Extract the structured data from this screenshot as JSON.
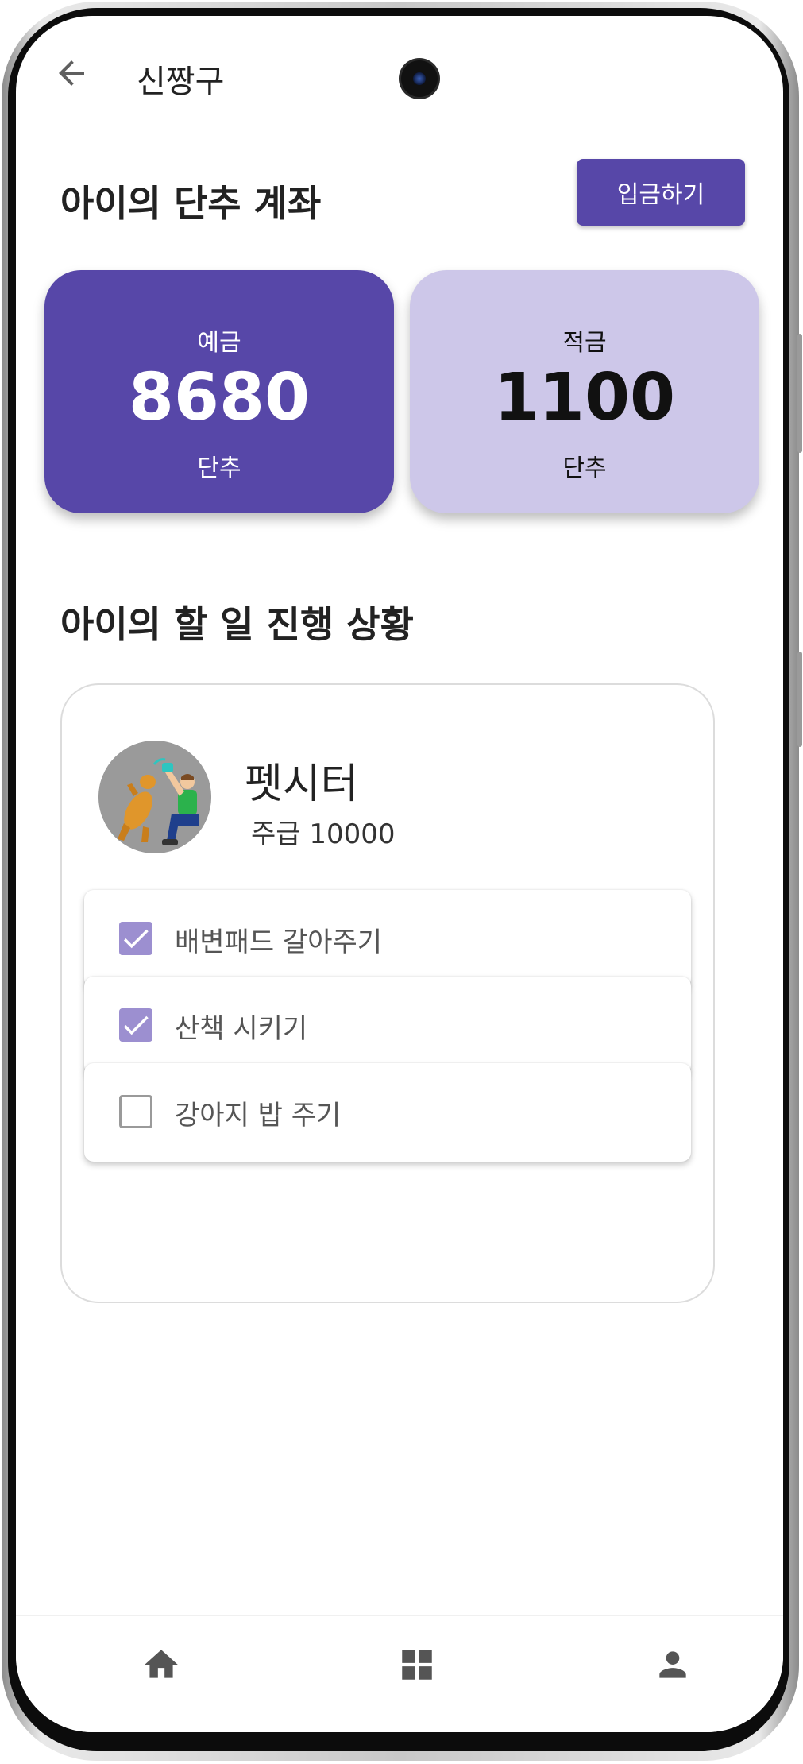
{
  "app_bar": {
    "title": "신짱구",
    "back_icon": "arrow-back-icon"
  },
  "account_section": {
    "title": "아이의 단추 계좌",
    "deposit_button": "입금하기",
    "accounts": [
      {
        "label": "예금",
        "value": "8680",
        "unit": "단추",
        "color": "#5747a8"
      },
      {
        "label": "적금",
        "value": "1100",
        "unit": "단추",
        "color": "#cdc7e9"
      }
    ]
  },
  "task_section": {
    "title": "아이의 할 일 진행 상황",
    "task": {
      "name": "펫시터",
      "pay": "주급 10000",
      "avatar_icon": "pet-sitter-avatar-icon"
    },
    "todos": [
      {
        "label": "배변패드 갈아주기",
        "checked": true
      },
      {
        "label": "산책 시키기",
        "checked": true
      },
      {
        "label": "강아지 밥 주기",
        "checked": false
      }
    ]
  },
  "bottom_nav": {
    "items": [
      {
        "icon": "home-icon"
      },
      {
        "icon": "grid-icon"
      },
      {
        "icon": "person-icon"
      }
    ]
  },
  "colors": {
    "primary": "#5747a8",
    "primary_light": "#cdc7e9",
    "checkbox": "#9c8fd0"
  }
}
